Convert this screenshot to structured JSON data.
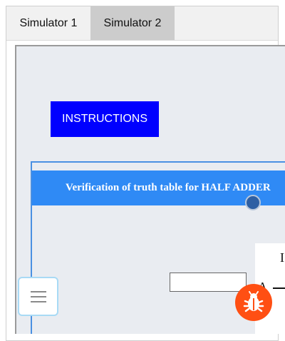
{
  "tabs": [
    {
      "label": "Simulator 1"
    },
    {
      "label": "Simulator 2"
    }
  ],
  "instructions": {
    "label": "INSTRUCTIONS"
  },
  "panel": {
    "title": "Verification of truth table for HALF ADDER",
    "partial_label_1": "I",
    "partial_label_2": "A",
    "input_value": ""
  },
  "icons": {
    "menu": "hamburger-menu-icon",
    "bug": "bug-report-icon"
  },
  "colors": {
    "instructions_bg": "#0000ff",
    "header_bg": "#2f8af5",
    "bug_bg": "#ff4f13",
    "active_tab": "#cccccc"
  }
}
